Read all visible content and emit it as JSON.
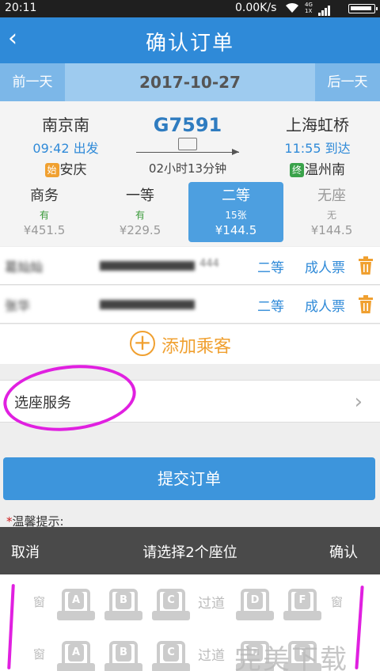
{
  "status_bar": {
    "time": "20:11",
    "rate": "0.00K/s",
    "network_top": "4G",
    "network_bottom": "1X"
  },
  "header": {
    "back_icon": "back-arrow-icon",
    "title": "确认订单"
  },
  "date_bar": {
    "prev_label": "前一天",
    "date": "2017-10-27",
    "next_label": "后一天"
  },
  "train": {
    "from": {
      "station": "南京南",
      "time": "09:42 出发",
      "tag": "始",
      "city": "安庆"
    },
    "number": "G7591",
    "duration": "02小时13分钟",
    "to": {
      "station": "上海虹桥",
      "time": "11:55 到达",
      "tag": "终",
      "city": "温州南"
    }
  },
  "seat_classes": [
    {
      "name": "商务",
      "availability": "有",
      "price": "¥451.5",
      "selected": false
    },
    {
      "name": "一等",
      "availability": "有",
      "price": "¥229.5",
      "selected": false
    },
    {
      "name": "二等",
      "availability": "15张",
      "price": "¥144.5",
      "selected": true
    },
    {
      "name": "无座",
      "availability": "无",
      "price": "¥144.5",
      "selected": false
    }
  ],
  "passengers": [
    {
      "name": "葛灿灿",
      "id_tail": "444",
      "seat_class": "二等",
      "ticket_type": "成人票"
    },
    {
      "name": "张华",
      "id_tail": "",
      "seat_class": "二等",
      "ticket_type": "成人票"
    }
  ],
  "add_passenger_label": "添加乘客",
  "service_label": "选座服务",
  "submit_label": "提交订单",
  "tip_star": "*",
  "tip_label": "温馨提示:",
  "seat_sheet": {
    "cancel_label": "取消",
    "prompt": "请选择2个座位",
    "confirm_label": "确认",
    "window_label": "窗",
    "aisle_label": "过道",
    "rows": [
      {
        "left": [
          "A",
          "B",
          "C"
        ],
        "right": [
          "D",
          "F"
        ]
      },
      {
        "left": [
          "A",
          "B",
          "C"
        ],
        "right": [
          "D",
          "F"
        ]
      }
    ]
  },
  "watermark": "完美下载",
  "colors": {
    "primary": "#2f8ad8",
    "accent": "#f0a030",
    "highlight": "#e020e0",
    "available": "#3a9a3a"
  }
}
